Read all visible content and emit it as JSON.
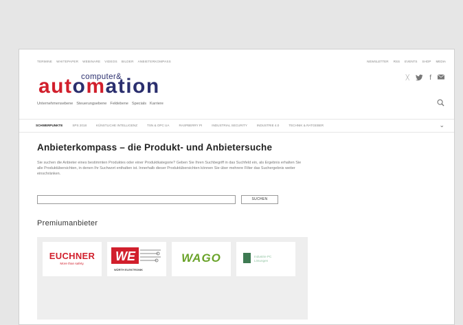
{
  "top_nav": {
    "left": [
      "TERMINE",
      "WHITEPAPER",
      "WEBINARE",
      "VIDEOS",
      "BILDER",
      "ANBIETERKOMPASS"
    ],
    "right": [
      "NEWSLETTER",
      "RSS",
      "EVENTS",
      "SHOP",
      "MEDIA"
    ]
  },
  "social_icons": [
    "xing-icon",
    "twitter-icon",
    "facebook-icon",
    "mail-icon"
  ],
  "logo": {
    "top": "computer&",
    "main_red": "aut",
    "main_blue_1": "o",
    "main_red_2": "m",
    "main_blue_2": "ation"
  },
  "sub_nav": [
    "Unternehmensebene",
    "Steuerungsebene",
    "Feldebene",
    "Specials",
    "Karriere"
  ],
  "category_nav": [
    "SCHWERPUNKTE",
    "SPS 2018",
    "KÜNSTLICHE INTELLIGENZ",
    "TSN & OPC UA",
    "RASPBERRY PI",
    "INDUSTRIAL SECURITY",
    "INDUSTRIE 4.0",
    "TECHNIK & RATGEBER"
  ],
  "main": {
    "heading": "Anbieterkompass – die Produkt- und Anbietersuche",
    "intro": "Sie suchen die Anbieter eines bestimmten Produktes oder einer Produktkategorie? Geben Sie Ihren Suchbegriff in das Suchfeld ein, als Ergebnis erhalten Sie alle Produktübersichten, in denen Ihr Suchwort enthalten ist. Innerhalb dieser Produktübersichten können Sie über mehrere Filter das Suchergebnis weiter einschränken.",
    "search_button": "SUCHEN",
    "search_value": ""
  },
  "premium": {
    "heading": "Premiumanbieter",
    "euchner_name": "EUCHNER",
    "euchner_tagline": "More than safety.",
    "wurth_caption": "WÜRTH ELEKTRONIK",
    "wago_name": "WAGO",
    "fourth_text_1": "Industrie PC",
    "fourth_text_2": "Lösungen"
  },
  "colors": {
    "brand_red": "#d11f2c",
    "brand_blue": "#2b2f6e",
    "wago_green": "#6aa32a"
  }
}
